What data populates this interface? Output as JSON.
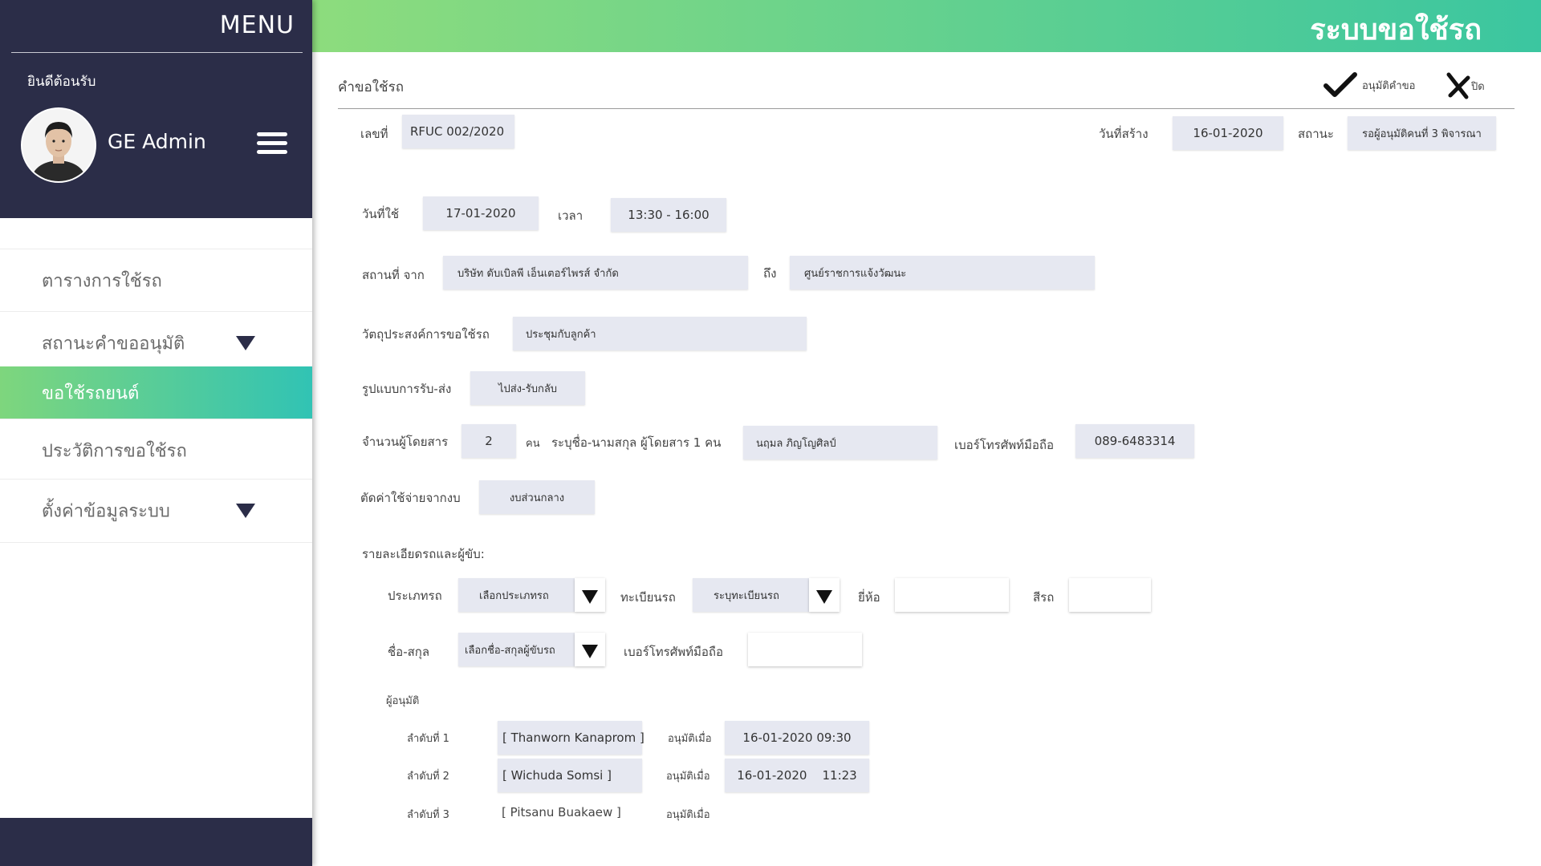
{
  "sidebar": {
    "menu_title": "MENU",
    "welcome": "ยินดีต้อนรับ",
    "username": "GE Admin",
    "items": [
      {
        "label": "ตารางการใช้รถ"
      },
      {
        "label": "สถานะคำขออนุมัติ"
      },
      {
        "label": "ขอใช้รถยนต์"
      },
      {
        "label": "ประวัติการขอใช้รถ"
      },
      {
        "label": "ตั้งค่าข้อมูลระบบ"
      }
    ]
  },
  "header": {
    "title": "ระบบขอใช้รถ"
  },
  "page": {
    "title": "คำขอใช้รถ",
    "approve_label": "อนุมัติคำขอ",
    "close_label": "ปิด"
  },
  "request": {
    "number_label": "เลขที่",
    "number": "RFUC 002/2020",
    "created_label": "วันที่สร้าง",
    "created": "16-01-2020",
    "status_label": "สถานะ",
    "status": "รอผู้อนุมัติคนที่ 3 พิจารณา",
    "date_label": "วันที่ใช้",
    "date": "17-01-2020",
    "time_label": "เวลา",
    "time": "13:30 - 16:00",
    "from_label": "สถานที่ จาก",
    "from": "บริษัท ดับเบิลพี เอ็นเตอร์ไพรส์ จำกัด",
    "to_label": "ถึง",
    "to": "ศูนย์ราชการแจ้งวัฒนะ",
    "purpose_label": "วัตถุประสงค์การขอใช้รถ",
    "purpose": "ประชุมกับลูกค้า",
    "pickup_label": "รูปแบบการรับ-ส่ง",
    "pickup": "ไปส่ง-รับกลับ",
    "passengers_label": "จำนวนผู้โดยสาร",
    "passengers": "2",
    "people_unit": "คน",
    "passenger_name_label": "ระบุชื่อ-นามสกุล ผู้โดยสาร 1 คน",
    "passenger_name": "นฤมล ภิญโญศิลป์",
    "mobile_label": "เบอร์โทรศัพท์มือถือ",
    "mobile": "089-6483314",
    "budget_label": "ตัดค่าใช้จ่ายจากงบ",
    "budget": "งบส่วนกลาง"
  },
  "vehicle": {
    "section_label": "รายละเอียดรถและผู้ขับ:",
    "type_label": "ประเภทรถ",
    "type_value": "เลือกประเภทรถ",
    "plate_label": "ทะเบียนรถ",
    "plate_value": "ระบุทะเบียนรถ",
    "brand_label": "ยี่ห้อ",
    "brand_value": "",
    "color_label": "สีรถ",
    "color_value": "",
    "driver_label": "ชื่อ-สกุล",
    "driver_value": "เลือกชื่อ-สกุลผู้ขับรถ",
    "driver_mobile_label": "เบอร์โทรศัพท์มือถือ",
    "driver_mobile_value": ""
  },
  "approvers": {
    "section_label": "ผู้อนุมัติ",
    "approved_at_label": "อนุมัติเมื่อ",
    "list": [
      {
        "order": "ลำดับที่ 1",
        "name": "[ Thanworn Kanaprom ]",
        "approved_at": "16-01-2020  09:30"
      },
      {
        "order": "ลำดับที่ 2",
        "name": "[ Wichuda Somsi ]",
        "approved_at": "16-01-2020    11:23"
      },
      {
        "order": "ลำดับที่ 3",
        "name": "[ Pitsanu Buakaew ]",
        "approved_at": ""
      }
    ]
  },
  "colors": {
    "sidebar_dark": "#2b2d48",
    "accent_start": "#7ed67d",
    "accent_end": "#31c3b4",
    "field_bg": "#e6e8f1"
  }
}
